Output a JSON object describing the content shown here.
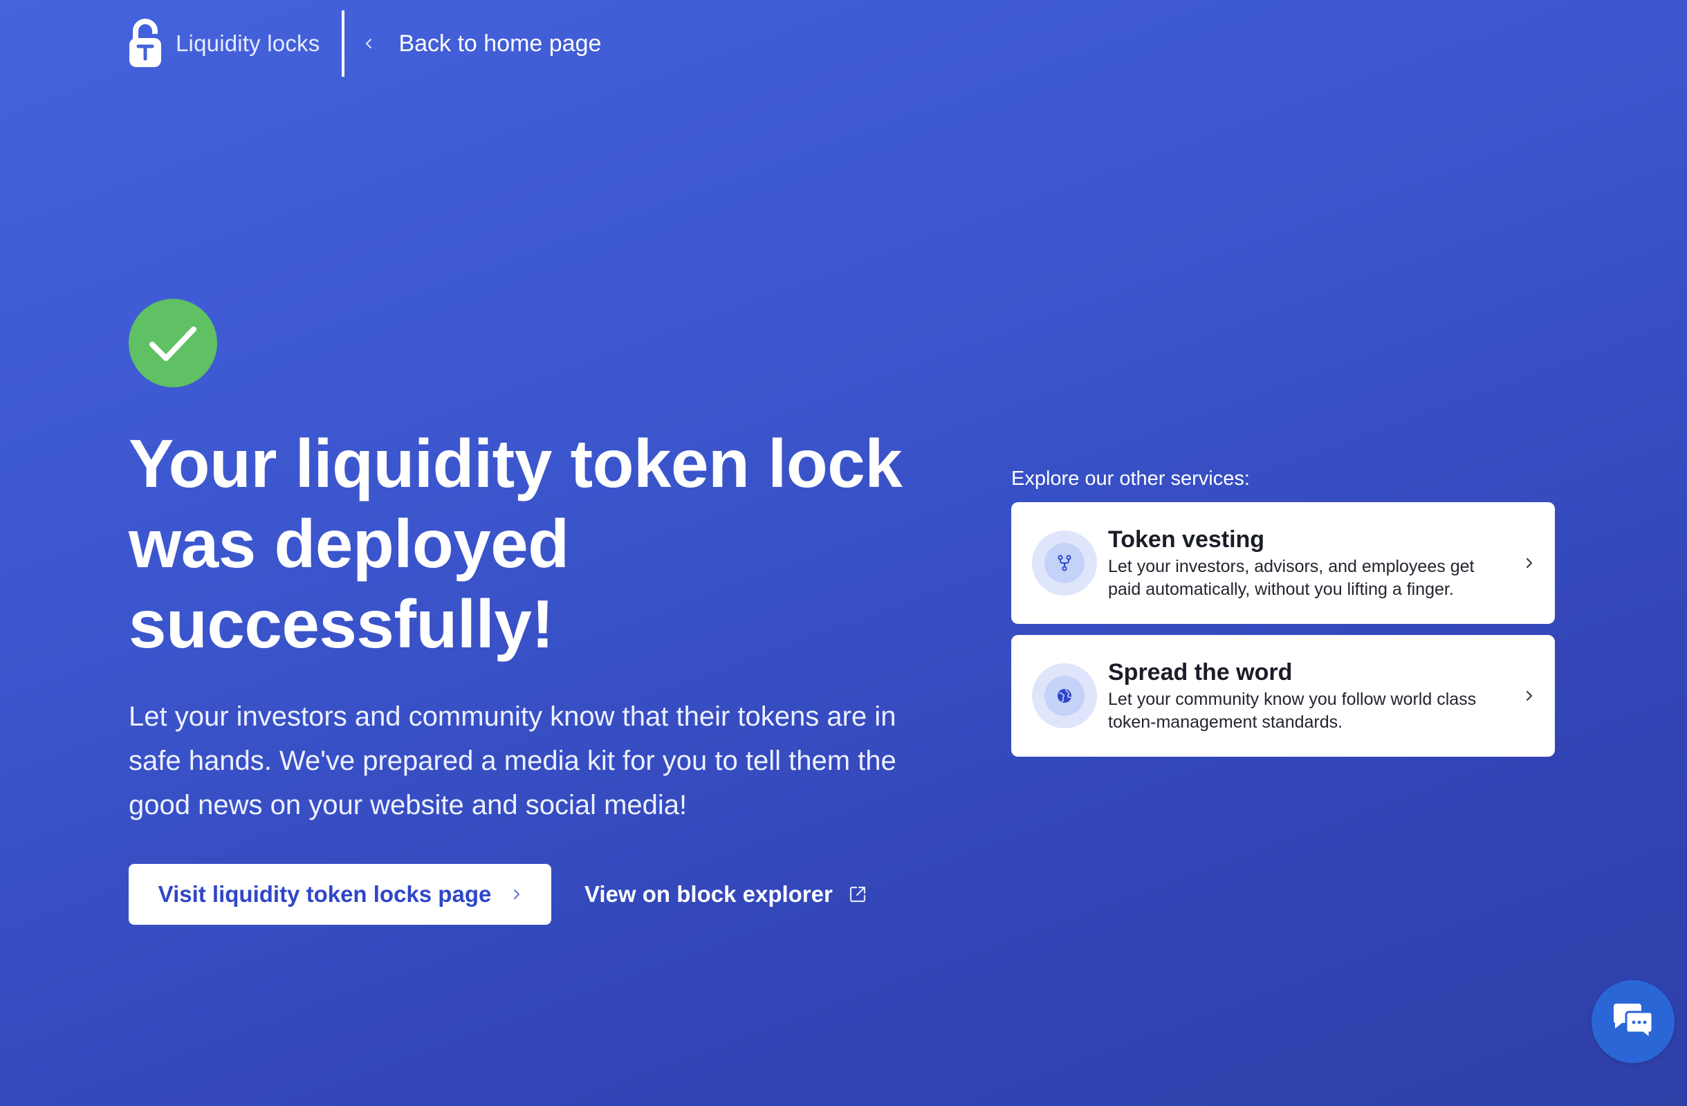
{
  "header": {
    "brand_name": "Liquidity locks",
    "back_label": "Back to home page"
  },
  "main": {
    "headline_lines": [
      "Your liquidity token lock",
      "was deployed",
      "successfully!"
    ],
    "lead_lines": [
      "Let your investors and community know that their tokens are in",
      "safe hands. We've prepared a media kit for you to tell them the",
      "good news on your website and social media!"
    ],
    "primary_button_label": "Visit liquidity token locks page",
    "secondary_link_label": "View on block explorer"
  },
  "services": {
    "title": "Explore our other services:",
    "items": [
      {
        "title": "Token vesting",
        "desc_lines": [
          "Let your investors, advisors, and employees get",
          "paid automatically, without you lifting a finger."
        ],
        "icon": "fork-icon"
      },
      {
        "title": "Spread the word",
        "desc_lines": [
          "Let your community know you follow world class",
          "token-management standards."
        ],
        "icon": "globe-icon"
      }
    ]
  },
  "icons": {
    "logo": "padlock-logo-icon",
    "success": "check-icon",
    "back": "chevron-left-icon",
    "primary_chevron": "chevron-right-icon",
    "external": "external-link-icon",
    "chat": "chat-icon"
  },
  "colors": {
    "background_start": "#4563dd",
    "background_end": "#2e3fa8",
    "success_green": "#5fc064",
    "primary_text": "#2f46c8",
    "chat_blue": "#2a66d6"
  }
}
